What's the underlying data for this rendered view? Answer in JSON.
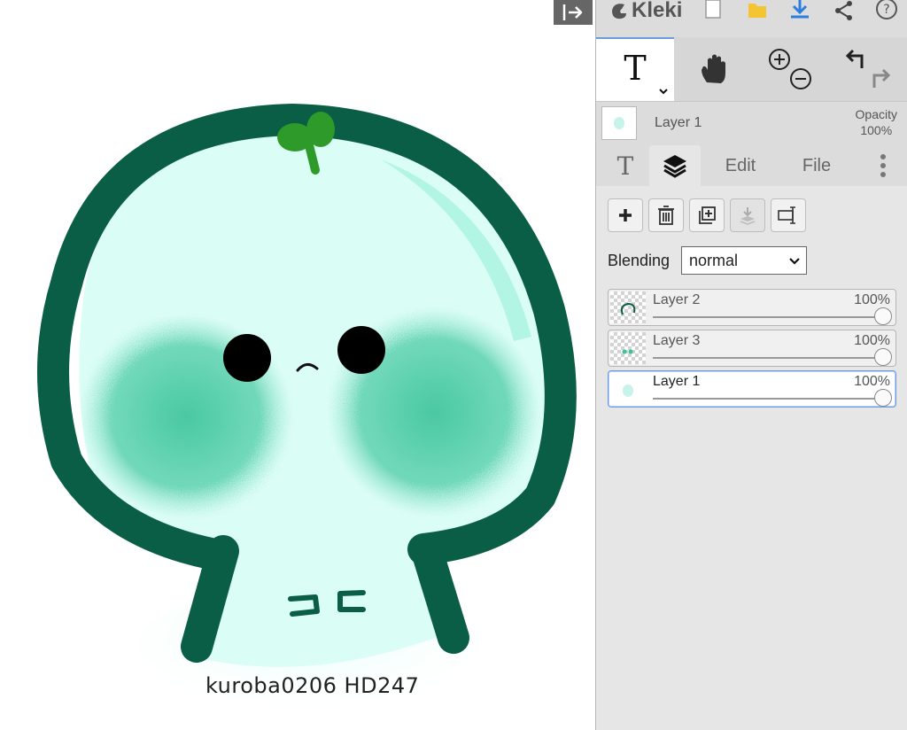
{
  "app": {
    "name": "Kleki"
  },
  "toolbar": {
    "tools": [
      {
        "name": "text",
        "icon": "text-tool-icon",
        "label": "T",
        "active": true
      },
      {
        "name": "hand",
        "icon": "hand-icon"
      },
      {
        "name": "zoom",
        "icon": "zoom-in-out-icon"
      },
      {
        "name": "undo-redo",
        "icon": "undo-redo-icon"
      }
    ]
  },
  "current_layer": {
    "name": "Layer 1",
    "opacity_label": "Opacity",
    "opacity_value": "100%"
  },
  "tabs": [
    {
      "label": "T",
      "icon": "text-tab-icon"
    },
    {
      "label": "",
      "icon": "layers-icon",
      "active": true
    },
    {
      "label": "Edit"
    },
    {
      "label": "File"
    },
    {
      "label": "",
      "icon": "more-vertical-icon"
    }
  ],
  "layers_panel": {
    "blending_label": "Blending",
    "blending_value": "normal",
    "layers": [
      {
        "name": "Layer 2",
        "opacity": "100%",
        "level": 1.0
      },
      {
        "name": "Layer 3",
        "opacity": "100%",
        "level": 1.0
      },
      {
        "name": "Layer 1",
        "opacity": "100%",
        "level": 1.0,
        "selected": true
      }
    ]
  },
  "artwork": {
    "caption": "kuroba0206 HD247",
    "colors": {
      "outline": "#0a5e45",
      "face": "#dafdf6",
      "cheeks": "#3cc49a",
      "sprout": "#2e9a2a"
    }
  },
  "colors": {
    "panel_bg": "#dcdcdc",
    "accent": "#2d7de0",
    "folder": "#f4c531"
  }
}
